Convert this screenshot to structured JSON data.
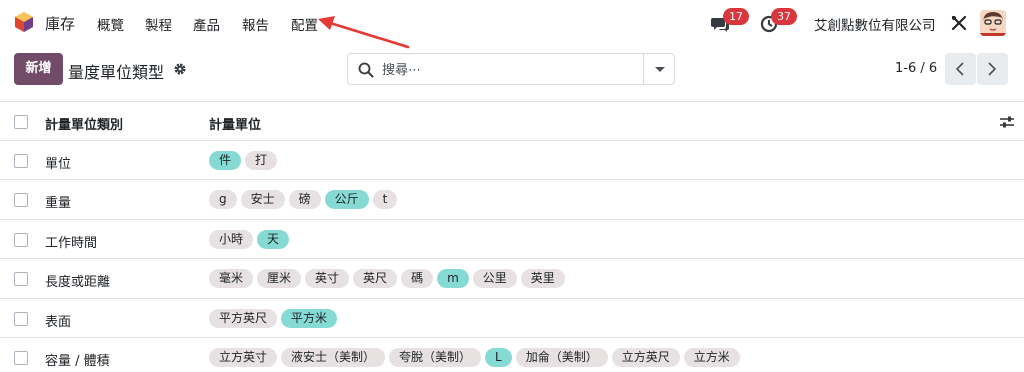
{
  "navbar": {
    "app_name": "庫存",
    "menus": [
      "概覽",
      "製程",
      "產品",
      "報告",
      "配置"
    ],
    "messages_count": "17",
    "activities_count": "37",
    "company": "艾創點數位有限公司"
  },
  "control": {
    "new_label": "新增",
    "breadcrumb": "量度單位類型",
    "search_placeholder": "搜尋⋯",
    "pager": "1-6 / 6"
  },
  "table": {
    "headers": [
      "計量單位類別",
      "計量單位"
    ],
    "rows": [
      {
        "name": "單位",
        "uoms": [
          {
            "label": "件",
            "ref": true
          },
          {
            "label": "打",
            "ref": false
          }
        ]
      },
      {
        "name": "重量",
        "uoms": [
          {
            "label": "g",
            "ref": false
          },
          {
            "label": "安士",
            "ref": false
          },
          {
            "label": "磅",
            "ref": false
          },
          {
            "label": "公斤",
            "ref": true
          },
          {
            "label": "t",
            "ref": false
          }
        ]
      },
      {
        "name": "工作時間",
        "uoms": [
          {
            "label": "小時",
            "ref": false
          },
          {
            "label": "天",
            "ref": true
          }
        ]
      },
      {
        "name": "長度或距離",
        "uoms": [
          {
            "label": "毫米",
            "ref": false
          },
          {
            "label": "厘米",
            "ref": false
          },
          {
            "label": "英寸",
            "ref": false
          },
          {
            "label": "英尺",
            "ref": false
          },
          {
            "label": "碼",
            "ref": false
          },
          {
            "label": "m",
            "ref": true
          },
          {
            "label": "公里",
            "ref": false
          },
          {
            "label": "英里",
            "ref": false
          }
        ]
      },
      {
        "name": "表面",
        "uoms": [
          {
            "label": "平方英尺",
            "ref": false
          },
          {
            "label": "平方米",
            "ref": true
          }
        ]
      },
      {
        "name": "容量 / 體積",
        "uoms": [
          {
            "label": "立方英寸",
            "ref": false
          },
          {
            "label": "液安士（美制）",
            "ref": false
          },
          {
            "label": "夸脫（美制）",
            "ref": false
          },
          {
            "label": "L",
            "ref": true
          },
          {
            "label": "加侖（美制）",
            "ref": false
          },
          {
            "label": "立方英尺",
            "ref": false
          },
          {
            "label": "立方米",
            "ref": false
          }
        ]
      }
    ]
  },
  "colors": {
    "primary": "#714b67",
    "reference_tag": "#86dad4",
    "tag": "#e7e1e1",
    "badge": "#d9363e",
    "annotation_arrow": "#e53935"
  }
}
